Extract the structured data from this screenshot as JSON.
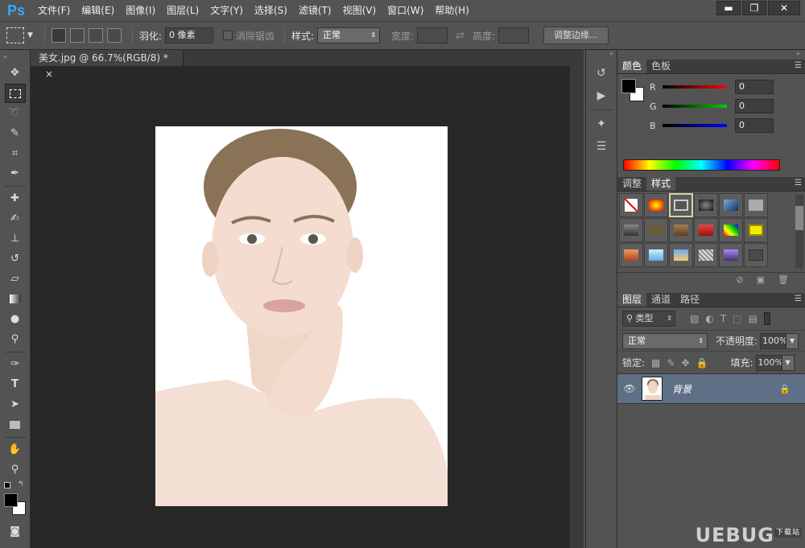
{
  "app": {
    "logo": "Ps"
  },
  "menu": [
    "文件(F)",
    "编辑(E)",
    "图像(I)",
    "图层(L)",
    "文字(Y)",
    "选择(S)",
    "滤镜(T)",
    "视图(V)",
    "窗口(W)",
    "帮助(H)"
  ],
  "window_controls": {
    "minimize": "▬",
    "restore": "❐",
    "close": "✕"
  },
  "options": {
    "feather_label": "羽化:",
    "feather_value": "0 像素",
    "antialias_label": "消除锯齿",
    "style_label": "样式:",
    "style_value": "正常",
    "width_label": "宽度:",
    "height_label": "高度:",
    "refine_edge_button": "调整边缘..."
  },
  "document": {
    "tab_title": "美女.jpg @ 66.7%(RGB/8) *",
    "close": "×"
  },
  "color_panel": {
    "tabs": [
      "颜色",
      "色板"
    ],
    "channels": [
      {
        "label": "R",
        "value": "0",
        "color": "#ff0000"
      },
      {
        "label": "G",
        "value": "0",
        "color": "#00c000"
      },
      {
        "label": "B",
        "value": "0",
        "color": "#0000ff"
      }
    ],
    "foreground": "#000000",
    "background": "#ffffff"
  },
  "styles_panel": {
    "tabs": [
      "调整",
      "样式"
    ]
  },
  "layers_panel": {
    "tabs": [
      "图层",
      "通道",
      "路径"
    ],
    "filter_label": "类型",
    "blend_mode": "正常",
    "opacity_label": "不透明度:",
    "opacity_value": "100%",
    "lock_label": "锁定:",
    "fill_label": "填充:",
    "fill_value": "100%",
    "layers": [
      {
        "name": "背景",
        "visible": true,
        "locked": true
      }
    ]
  },
  "watermark": "UEBUG",
  "watermark_sub": "下载站"
}
